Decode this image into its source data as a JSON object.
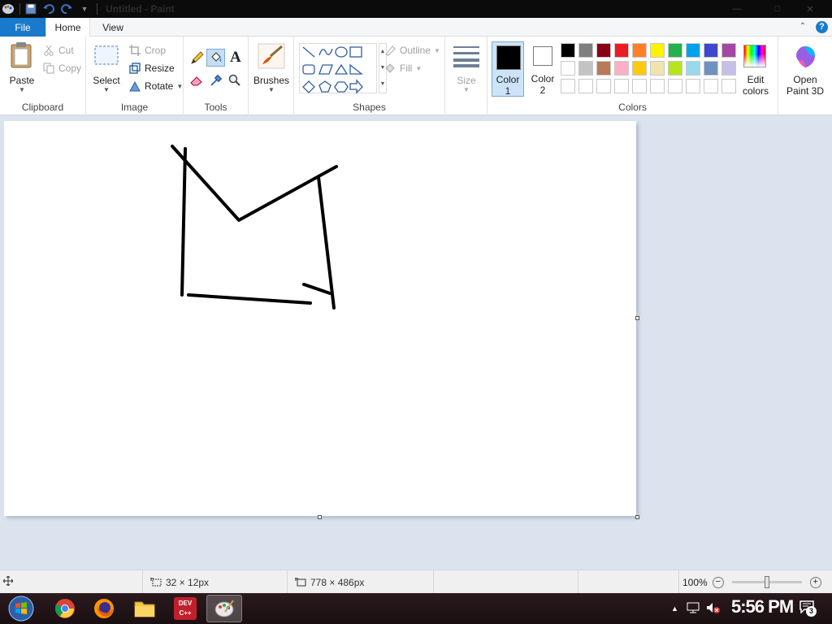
{
  "window": {
    "title": "Untitled - Paint",
    "controls": {
      "minimize": "—",
      "maximize": "□",
      "close": "✕"
    }
  },
  "tabs": {
    "file": "File",
    "home": "Home",
    "view": "View",
    "help": "?"
  },
  "ribbon": {
    "clipboard": {
      "label": "Clipboard",
      "paste": "Paste",
      "cut": "Cut",
      "copy": "Copy"
    },
    "image": {
      "label": "Image",
      "select": "Select",
      "crop": "Crop",
      "resize": "Resize",
      "rotate": "Rotate"
    },
    "tools": {
      "label": "Tools",
      "text_glyph": "A"
    },
    "brushes": {
      "label": "Brushes"
    },
    "shapes": {
      "label": "Shapes",
      "outline": "Outline",
      "fill": "Fill"
    },
    "size": {
      "label": "Size"
    },
    "colors": {
      "label": "Colors",
      "color1_label": "Color",
      "color1_num": "1",
      "color2_label": "Color",
      "color2_num": "2",
      "color1": "#000000",
      "color2": "#ffffff",
      "edit_label": "Edit",
      "edit_label2": "colors",
      "palette_row1": [
        "#000000",
        "#7f7f7f",
        "#880015",
        "#ed1c24",
        "#ff7f27",
        "#fff200",
        "#22b14c",
        "#00a2e8",
        "#3f48cc",
        "#a349a4"
      ],
      "palette_row2": [
        "#ffffff",
        "#c3c3c3",
        "#b97a57",
        "#ffaec9",
        "#ffc90e",
        "#efe4b0",
        "#b5e61d",
        "#99d9ea",
        "#7092be",
        "#c8bfe7"
      ],
      "palette_row3": [
        "#ffffff",
        "#ffffff",
        "#ffffff",
        "#ffffff",
        "#ffffff",
        "#ffffff",
        "#ffffff",
        "#ffffff",
        "#ffffff",
        "#ffffff"
      ]
    },
    "paint3d": {
      "line1": "Open",
      "line2": "Paint 3D"
    }
  },
  "status": {
    "selection_size": "32 × 12px",
    "canvas_size": "778 × 486px",
    "zoom": "100%",
    "zoom_fraction": 0.5
  },
  "taskbar": {
    "clock": "5:56 PM",
    "notification_count": "3",
    "apps": [
      "start-orb",
      "chrome",
      "firefox",
      "file-explorer",
      "dev-cpp",
      "paint"
    ],
    "devcpp_label": "DEV C++"
  }
}
